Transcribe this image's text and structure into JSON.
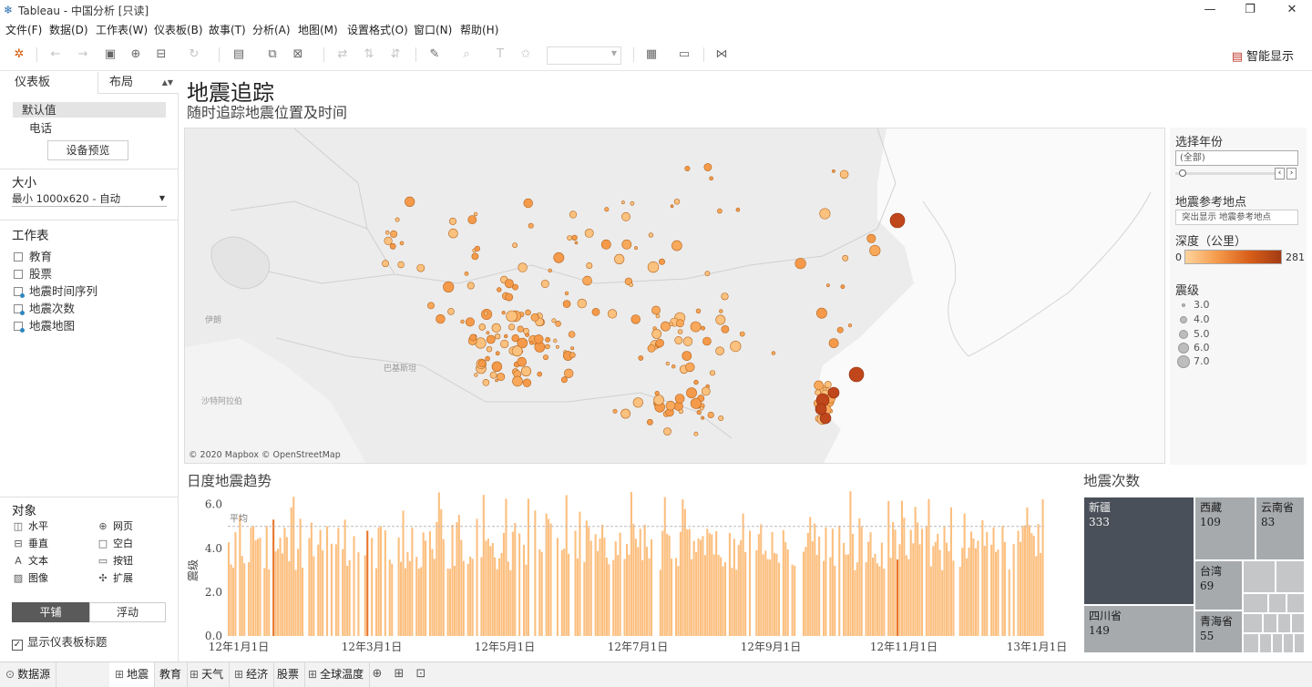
{
  "window": {
    "title": "Tableau - 中国分析 [只读]"
  },
  "menu": [
    "文件(F)",
    "数据(D)",
    "工作表(W)",
    "仪表板(B)",
    "故事(T)",
    "分析(A)",
    "地图(M)",
    "设置格式(O)",
    "窗口(N)",
    "帮助(H)"
  ],
  "toolbar": {
    "smart_label": "智能显示"
  },
  "left": {
    "tab_dashboard": "仪表板",
    "tab_layout": "布局",
    "device_default": "默认值",
    "device_phone": "电话",
    "preview_button": "设备预览",
    "size_heading": "大小",
    "size_value": "最小 1000x620 - 自动",
    "sheets_heading": "工作表",
    "sheets": [
      "教育",
      "股票",
      "地震时间序列",
      "地震次数",
      "地震地图"
    ],
    "objects_heading": "对象",
    "objects": [
      "水平",
      "网页",
      "垂直",
      "空白",
      "文本",
      "按钮",
      "图像",
      "扩展"
    ],
    "tile_button": "平铺",
    "float_button": "浮动",
    "show_title": "显示仪表板标题"
  },
  "dashboard": {
    "title": "地震追踪",
    "subtitle": "随时追踪地震位置及时间"
  },
  "map": {
    "credit": "© 2020 Mapbox © OpenStreetMap",
    "labels": [
      "伊朗",
      "巴基斯坦",
      "沙特阿拉伯"
    ]
  },
  "filters": {
    "year_heading": "选择年份",
    "year_value": "(全部)",
    "ref_heading": "地震参考地点",
    "ref_placeholder": "突出显示 地震参考地点",
    "depth_heading": "深度（公里）",
    "depth_min": "0",
    "depth_max": "281",
    "mag_heading": "震级",
    "mag_values": [
      "3.0",
      "4.0",
      "5.0",
      "6.0",
      "7.0"
    ]
  },
  "trend": {
    "title": "日度地震趋势",
    "ylabel": "震级",
    "avg_label": "平均"
  },
  "chart_data": {
    "type": "bar",
    "title": "日度地震趋势",
    "ylabel": "震级",
    "ylim": [
      0,
      6.4
    ],
    "yticks": [
      "0.0",
      "2.0",
      "4.0",
      "6.0"
    ],
    "xticks": [
      "12年1月1日",
      "12年3月1日",
      "12年5月1日",
      "12年7月1日",
      "12年9月1日",
      "12年11月1日",
      "13年1月1日"
    ],
    "average": 5.0,
    "color": "#fcbf7f",
    "highlight_color": "#e8742a",
    "highlight_days": [
      40,
      124,
      235,
      403,
      598
    ],
    "days_shown": 365,
    "values_by_day": "approximately 3.0–6.6 on most days; individual daily values are not legible"
  },
  "count": {
    "title": "地震次数",
    "cells": [
      {
        "name": "新疆",
        "value": "333"
      },
      {
        "name": "西藏",
        "value": "109"
      },
      {
        "name": "云南省",
        "value": "83"
      },
      {
        "name": "台湾",
        "value": "69"
      },
      {
        "name": "四川省",
        "value": "149"
      },
      {
        "name": "青海省",
        "value": "55"
      }
    ]
  },
  "tabs": {
    "datasource": "数据源",
    "sheets": [
      "地震",
      "教育",
      "天气",
      "经济",
      "股票",
      "全球温度"
    ]
  }
}
